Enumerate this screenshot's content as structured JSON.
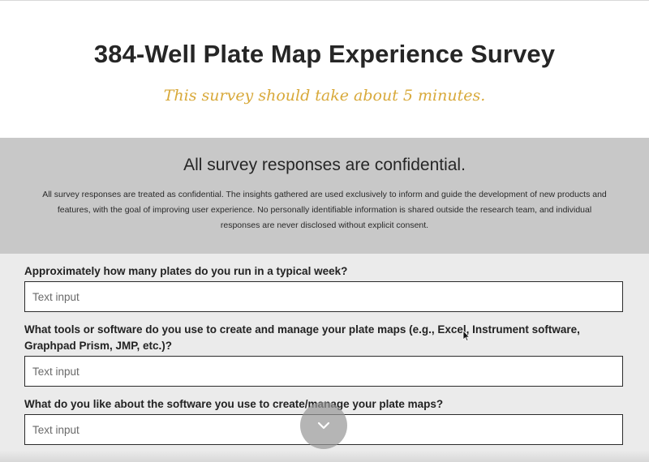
{
  "header": {
    "title": "384-Well Plate Map Experience Survey",
    "subtitle": "This survey should take about 5 minutes."
  },
  "notice": {
    "heading": "All survey responses are confidential.",
    "body": "All survey responses are treated as confidential. The insights gathered are used exclusively to inform and guide the development of new products and features, with the goal of improving user experience. No personally identifiable information is shared outside the research team, and individual responses are never disclosed without explicit consent."
  },
  "questions": [
    {
      "label": "Approximately how many plates do you run in a typical week?",
      "placeholder": "Text input",
      "value": ""
    },
    {
      "label": "What tools or software do you use to create and manage your plate maps (e.g., Excel, Instrument software, Graphpad Prism, JMP, etc.)?",
      "placeholder": "Text input",
      "value": ""
    },
    {
      "label": "What do you like about the software you use to create/manage your plate maps?",
      "placeholder": "Text input",
      "value": ""
    }
  ],
  "scroll_button": {
    "icon": "chevron-down-icon"
  },
  "colors": {
    "subtitle": "#d8a93a",
    "notice_bg": "#c8c8c8",
    "form_bg": "#ebebeb",
    "input_border": "#2b2b2b"
  }
}
